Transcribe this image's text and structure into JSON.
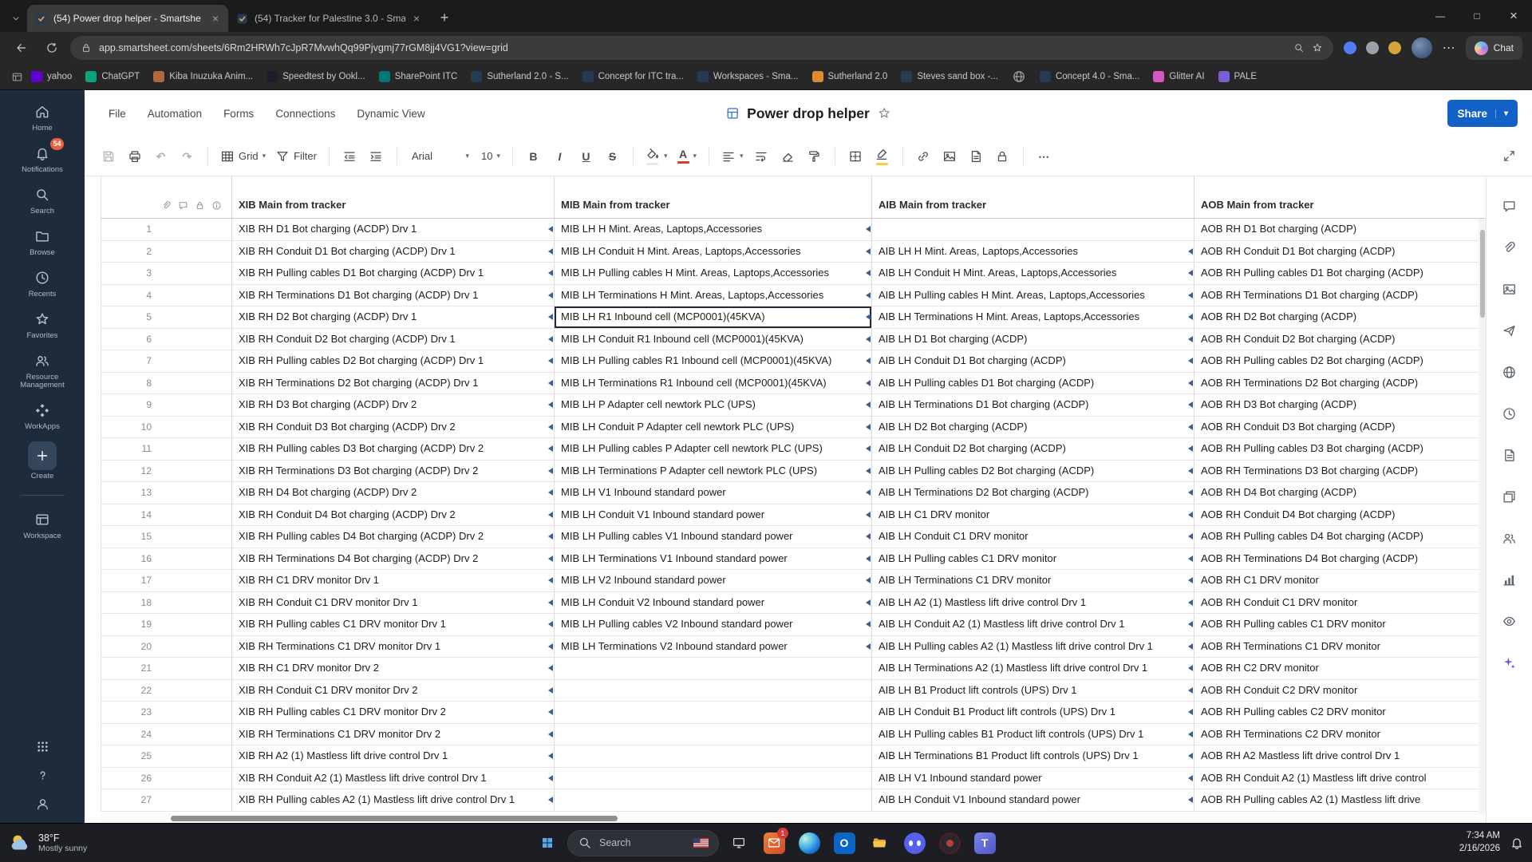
{
  "browser": {
    "tabs": [
      {
        "title": "(54) Power drop helper - Smartshe",
        "active": true
      },
      {
        "title": "(54) Tracker for Palestine 3.0 - Sma",
        "active": false
      }
    ],
    "url": "app.smartsheet.com/sheets/6Rm2HRWh7cJpR7MvwhQq99Pjvgmj77rGM8jj4VG1?view=grid",
    "chat_label": "Chat",
    "extensions": [
      "#4f7df0",
      "#9aa0a6",
      "#d8a33c"
    ],
    "bookmarks": [
      {
        "label": "yahoo",
        "fav": "#5f01d1"
      },
      {
        "label": "ChatGPT",
        "fav": "#0ea37f"
      },
      {
        "label": "Kiba Inuzuka Anim...",
        "fav": "#b06a3e"
      },
      {
        "label": "Speedtest by Ookl...",
        "fav": "#1b1e2e"
      },
      {
        "label": "SharePoint ITC",
        "fav": "#03787c"
      },
      {
        "label": "Sutherland 2.0 - S...",
        "fav": "#243a57"
      },
      {
        "label": "Concept for ITC tra...",
        "fav": "#243a57"
      },
      {
        "label": "Workspaces - Sma...",
        "fav": "#243a57"
      },
      {
        "label": "Sutherland 2.0",
        "fav": "#e08b2e"
      },
      {
        "label": "Steves sand box -...",
        "fav": "#243a57"
      },
      {
        "label": "",
        "fav": "globe"
      },
      {
        "label": "Concept 4.0 - Sma...",
        "fav": "#243a57"
      },
      {
        "label": "Glitter AI",
        "fav": "#d357c4"
      },
      {
        "label": "PALE",
        "fav": "#7b5cd6"
      }
    ]
  },
  "sidebar": {
    "items": [
      {
        "label": "Home",
        "icon": "home"
      },
      {
        "label": "Notifications",
        "icon": "bell",
        "badge": "54"
      },
      {
        "label": "Search",
        "icon": "search"
      },
      {
        "label": "Browse",
        "icon": "folder"
      },
      {
        "label": "Recents",
        "icon": "clock"
      },
      {
        "label": "Favorites",
        "icon": "star"
      },
      {
        "label": "Resource Management",
        "icon": "users"
      },
      {
        "label": "WorkApps",
        "icon": "diamonds"
      },
      {
        "label": "Create",
        "icon": "plus",
        "create": true
      },
      {
        "divider": true
      },
      {
        "label": "Workspace",
        "icon": "workspace"
      }
    ],
    "bottom": [
      {
        "name": "apps",
        "icon": "dots"
      },
      {
        "name": "help",
        "icon": "help"
      },
      {
        "name": "account",
        "icon": "person"
      }
    ]
  },
  "menubar": {
    "menus": [
      "File",
      "Automation",
      "Forms",
      "Connections",
      "Dynamic View"
    ],
    "title": "Power drop helper",
    "share_label": "Share"
  },
  "toolbar": {
    "items": [
      {
        "name": "save",
        "icon": "save",
        "muted": true
      },
      {
        "name": "print",
        "icon": "print"
      },
      {
        "name": "undo",
        "glyph": "↶",
        "muted": true
      },
      {
        "name": "redo",
        "glyph": "↷",
        "muted": true
      },
      {
        "sep": true
      },
      {
        "name": "view-mode",
        "icon": "grid",
        "label": "Grid",
        "caret": true
      },
      {
        "name": "filter",
        "icon": "funnel",
        "label": "Filter"
      },
      {
        "sep": true
      },
      {
        "name": "outdent",
        "icon": "outdent"
      },
      {
        "name": "indent",
        "icon": "indent"
      },
      {
        "sep": true
      },
      {
        "name": "font-family",
        "label": "Arial",
        "caret": true,
        "wide": true
      },
      {
        "name": "font-size",
        "label": "10",
        "caret": true
      },
      {
        "sep": true
      },
      {
        "name": "bold",
        "glyph": "B",
        "cls": "gb"
      },
      {
        "name": "italic",
        "glyph": "I",
        "cls": "gi"
      },
      {
        "name": "underline",
        "glyph": "U",
        "cls": "gu"
      },
      {
        "name": "strikethrough",
        "glyph": "S",
        "cls": "gs"
      },
      {
        "sep": true
      },
      {
        "name": "fill-color",
        "icon": "fill",
        "caret": true,
        "bar": "#e8e8e8"
      },
      {
        "name": "text-color",
        "glyph": "A",
        "cls": "ga",
        "caret": true,
        "bar": "#e03b24"
      },
      {
        "sep": true
      },
      {
        "name": "align",
        "icon": "align",
        "caret": true
      },
      {
        "name": "wrap-text",
        "icon": "wrap"
      },
      {
        "name": "clear-format",
        "icon": "eraser"
      },
      {
        "name": "format-painter",
        "icon": "paint"
      },
      {
        "sep": true
      },
      {
        "name": "borders",
        "icon": "borders"
      },
      {
        "name": "highlight",
        "icon": "marker",
        "bar": "#f2cf3c"
      },
      {
        "sep": true
      },
      {
        "name": "insert-link",
        "icon": "link"
      },
      {
        "name": "insert-image",
        "icon": "image"
      },
      {
        "name": "export",
        "icon": "doc"
      },
      {
        "name": "lock",
        "icon": "lock"
      },
      {
        "sep": true
      },
      {
        "name": "more-options",
        "glyph": "⋯"
      }
    ]
  },
  "grid": {
    "columns": [
      "XIB Main from tracker",
      "MIB Main from tracker",
      "AIB Main from tracker",
      "AOB Main from tracker"
    ],
    "header_icons": [
      "clip",
      "comment",
      "lock",
      "info"
    ],
    "selected": {
      "row": 5,
      "col": "mib"
    },
    "rows": [
      {
        "n": 1,
        "xib": "XIB RH D1 Bot charging (ACDP) Drv 1",
        "mib": "MIB LH H Mint. Areas, Laptops,Accessories",
        "aib": "",
        "aob": "AOB RH D1 Bot charging (ACDP)"
      },
      {
        "n": 2,
        "xib": "XIB RH Conduit D1 Bot charging (ACDP) Drv 1",
        "mib": "MIB LH Conduit H Mint. Areas, Laptops,Accessories",
        "aib": "AIB LH H Mint. Areas, Laptops,Accessories",
        "aob": "AOB RH Conduit D1 Bot charging (ACDP)"
      },
      {
        "n": 3,
        "xib": "XIB RH Pulling cables D1 Bot charging (ACDP) Drv 1",
        "mib": "MIB LH Pulling cables H Mint. Areas, Laptops,Accessories",
        "aib": "AIB LH Conduit H Mint. Areas, Laptops,Accessories",
        "aob": "AOB RH Pulling cables D1 Bot charging (ACDP)"
      },
      {
        "n": 4,
        "xib": "XIB RH Terminations D1 Bot charging (ACDP) Drv 1",
        "mib": "MIB LH Terminations H Mint. Areas, Laptops,Accessories",
        "aib": "AIB LH Pulling cables H Mint. Areas, Laptops,Accessories",
        "aob": "AOB RH Terminations D1 Bot charging (ACDP)"
      },
      {
        "n": 5,
        "xib": "XIB RH D2 Bot charging (ACDP) Drv 1",
        "mib": "MIB LH R1 Inbound cell (MCP0001)(45KVA)",
        "aib": "AIB LH Terminations H Mint. Areas, Laptops,Accessories",
        "aob": "AOB RH D2 Bot charging (ACDP)"
      },
      {
        "n": 6,
        "xib": "XIB RH Conduit D2 Bot charging (ACDP) Drv 1",
        "mib": "MIB LH Conduit R1 Inbound cell (MCP0001)(45KVA)",
        "aib": "AIB LH D1 Bot charging (ACDP)",
        "aob": "AOB RH Conduit D2 Bot charging (ACDP)"
      },
      {
        "n": 7,
        "xib": "XIB RH Pulling cables D2 Bot charging (ACDP) Drv 1",
        "mib": "MIB LH Pulling cables R1 Inbound cell (MCP0001)(45KVA)",
        "aib": "AIB LH Conduit D1 Bot charging (ACDP)",
        "aob": "AOB RH Pulling cables D2 Bot charging (ACDP)"
      },
      {
        "n": 8,
        "xib": "XIB RH Terminations D2 Bot charging (ACDP) Drv 1",
        "mib": "MIB LH Terminations R1 Inbound cell (MCP0001)(45KVA)",
        "aib": "AIB LH Pulling cables D1 Bot charging (ACDP)",
        "aob": "AOB RH Terminations D2 Bot charging (ACDP)"
      },
      {
        "n": 9,
        "xib": "XIB RH D3 Bot charging (ACDP) Drv 2",
        "mib": "MIB LH P Adapter cell newtork PLC (UPS)",
        "aib": "AIB LH Terminations D1 Bot charging (ACDP)",
        "aob": "AOB RH D3 Bot charging (ACDP)"
      },
      {
        "n": 10,
        "xib": "XIB RH Conduit D3 Bot charging (ACDP) Drv 2",
        "mib": "MIB LH Conduit P Adapter cell newtork PLC (UPS)",
        "aib": "AIB LH D2 Bot charging (ACDP)",
        "aob": "AOB RH Conduit D3 Bot charging (ACDP)"
      },
      {
        "n": 11,
        "xib": "XIB RH Pulling cables D3 Bot charging (ACDP) Drv 2",
        "mib": "MIB LH Pulling cables P Adapter cell newtork PLC (UPS)",
        "aib": "AIB LH Conduit D2 Bot charging (ACDP)",
        "aob": "AOB RH Pulling cables D3 Bot charging (ACDP)"
      },
      {
        "n": 12,
        "xib": "XIB RH Terminations D3 Bot charging (ACDP) Drv 2",
        "mib": "MIB LH Terminations P Adapter cell newtork PLC (UPS)",
        "aib": "AIB LH Pulling cables D2 Bot charging (ACDP)",
        "aob": "AOB RH Terminations D3 Bot charging (ACDP)"
      },
      {
        "n": 13,
        "xib": "XIB RH D4 Bot charging (ACDP) Drv 2",
        "mib": "MIB LH V1 Inbound standard power",
        "aib": "AIB LH Terminations D2 Bot charging (ACDP)",
        "aob": "AOB RH D4 Bot charging (ACDP)"
      },
      {
        "n": 14,
        "xib": "XIB RH Conduit D4 Bot charging (ACDP) Drv 2",
        "mib": "MIB LH Conduit V1 Inbound standard power",
        "aib": "AIB LH C1 DRV monitor",
        "aob": "AOB RH Conduit D4 Bot charging (ACDP)"
      },
      {
        "n": 15,
        "xib": "XIB RH Pulling cables D4 Bot charging (ACDP) Drv 2",
        "mib": "MIB LH Pulling cables V1 Inbound standard power",
        "aib": "AIB LH Conduit C1 DRV monitor",
        "aob": "AOB RH Pulling cables D4 Bot charging (ACDP)"
      },
      {
        "n": 16,
        "xib": "XIB RH Terminations D4 Bot charging (ACDP) Drv 2",
        "mib": "MIB LH Terminations V1 Inbound standard power",
        "aib": "AIB LH Pulling cables C1 DRV monitor",
        "aob": "AOB RH Terminations D4 Bot charging (ACDP)"
      },
      {
        "n": 17,
        "xib": "XIB RH C1 DRV monitor Drv 1",
        "mib": "MIB LH V2 Inbound standard power",
        "aib": "AIB LH Terminations C1 DRV monitor",
        "aob": "AOB RH C1 DRV monitor"
      },
      {
        "n": 18,
        "xib": "XIB RH Conduit C1 DRV monitor Drv 1",
        "mib": "MIB LH Conduit V2 Inbound standard power",
        "aib": "AIB LH A2 (1) Mastless lift drive control Drv 1",
        "aob": "AOB RH Conduit C1 DRV monitor"
      },
      {
        "n": 19,
        "xib": "XIB RH Pulling cables C1 DRV monitor Drv 1",
        "mib": "MIB LH Pulling cables V2 Inbound standard power",
        "aib": "AIB LH Conduit A2 (1) Mastless lift drive control Drv 1",
        "aob": "AOB RH Pulling cables C1 DRV monitor"
      },
      {
        "n": 20,
        "xib": "XIB RH Terminations C1 DRV monitor Drv 1",
        "mib": "MIB LH Terminations V2 Inbound standard power",
        "aib": "AIB LH Pulling cables A2 (1) Mastless lift drive control Drv 1",
        "aob": "AOB RH Terminations C1 DRV monitor"
      },
      {
        "n": 21,
        "xib": "XIB RH C1 DRV monitor Drv 2",
        "mib": "",
        "aib": "AIB LH Terminations A2 (1) Mastless lift drive control Drv 1",
        "aob": "AOB RH C2 DRV monitor"
      },
      {
        "n": 22,
        "xib": "XIB RH Conduit C1 DRV monitor Drv 2",
        "mib": "",
        "aib": "AIB LH B1 Product lift controls (UPS) Drv 1",
        "aob": "AOB RH Conduit C2 DRV monitor"
      },
      {
        "n": 23,
        "xib": "XIB RH Pulling cables C1 DRV monitor Drv 2",
        "mib": "",
        "aib": "AIB LH Conduit B1 Product lift controls (UPS) Drv 1",
        "aob": "AOB RH Pulling cables C2 DRV monitor"
      },
      {
        "n": 24,
        "xib": "XIB RH Terminations C1 DRV monitor Drv 2",
        "mib": "",
        "aib": "AIB LH Pulling cables B1 Product lift controls (UPS) Drv 1",
        "aob": "AOB RH Terminations C2 DRV monitor"
      },
      {
        "n": 25,
        "xib": "XIB RH A2 (1) Mastless lift drive control Drv 1",
        "mib": "",
        "aib": "AIB LH Terminations B1 Product lift controls (UPS) Drv 1",
        "aob": "AOB RH A2 Mastless lift drive control Drv 1"
      },
      {
        "n": 26,
        "xib": "XIB RH Conduit A2 (1) Mastless lift drive control Drv 1",
        "mib": "",
        "aib": "AIB LH V1 Inbound standard power",
        "aob": "AOB RH Conduit A2 (1) Mastless lift drive control"
      },
      {
        "n": 27,
        "xib": "XIB RH Pulling cables A2 (1) Mastless lift drive control Drv 1",
        "mib": "",
        "aib": "AIB LH Conduit V1 Inbound standard power",
        "aob": "AOB RH Pulling cables A2 (1) Mastless lift drive"
      }
    ]
  },
  "rail": {
    "items": [
      {
        "name": "comments",
        "icon": "comment"
      },
      {
        "name": "attachments",
        "icon": "clip"
      },
      {
        "name": "proofs",
        "icon": "image"
      },
      {
        "name": "update-requests",
        "icon": "send"
      },
      {
        "name": "publish",
        "icon": "globe"
      },
      {
        "name": "activity-log",
        "icon": "clock"
      },
      {
        "name": "sheet-summary",
        "icon": "doc"
      },
      {
        "name": "connections",
        "icon": "layers"
      },
      {
        "name": "collaborators",
        "icon": "users"
      },
      {
        "name": "charts",
        "icon": "chart"
      },
      {
        "name": "dynamic-view",
        "icon": "eye"
      },
      {
        "name": "ai-assistant",
        "icon": "sparkle"
      }
    ]
  },
  "taskbar": {
    "weather": {
      "temp": "38°F",
      "desc": "Mostly sunny"
    },
    "search_placeholder": "Search",
    "apps": [
      {
        "name": "pc-manager",
        "style": "monitor"
      },
      {
        "name": "mail",
        "style": "mail",
        "badge": "1"
      },
      {
        "name": "edge",
        "style": "edge"
      },
      {
        "name": "outlook",
        "style": "outlook"
      },
      {
        "name": "file-explorer",
        "style": "folder"
      },
      {
        "name": "discord",
        "style": "discord"
      },
      {
        "name": "media-app",
        "style": "dark"
      },
      {
        "name": "teams",
        "style": "teams"
      }
    ],
    "tray": {
      "time": "7:34 AM",
      "date": "2/16/2026"
    }
  },
  "colors": {
    "accent_blue": "#1161c6",
    "sidebar_bg": "#1e2b3b",
    "badge_orange": "#e8633a",
    "selection": "#222b38",
    "link_arrow": "#3a5e96"
  }
}
